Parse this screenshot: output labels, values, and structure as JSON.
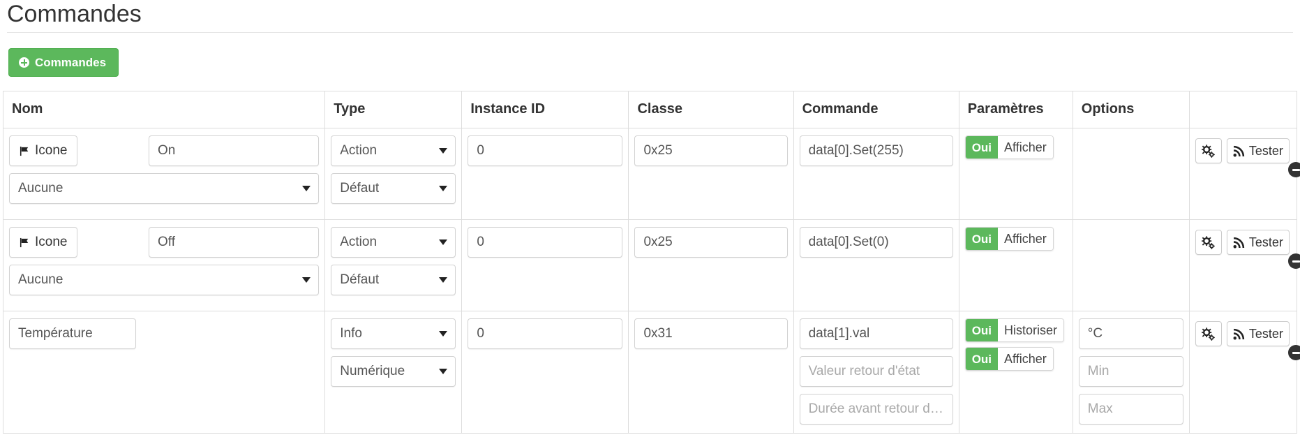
{
  "page": {
    "title": "Commandes"
  },
  "toolbar": {
    "add_label": "Commandes",
    "add_icon": "plus-circle-icon",
    "accent_color": "#5cb85c"
  },
  "table": {
    "headers": [
      "Nom",
      "Type",
      "Instance ID",
      "Classe",
      "Commande",
      "Paramètres",
      "Options",
      ""
    ],
    "icon_button_label": "Icone",
    "icon_button_icon": "flag-icon",
    "test_button_label": "Tester",
    "test_button_icon": "rss-signal-icon",
    "config_button_icon": "gears-icon",
    "remove_button_icon": "minus-circle-icon",
    "rows": [
      {
        "name_value": "On",
        "icon_select_value": "Aucune",
        "type_value": "Action",
        "subtype_value": "Défaut",
        "instance_id": "0",
        "classe": "0x25",
        "commande": "data[0].Set(255)",
        "params": [
          {
            "state": "Oui",
            "label": "Afficher"
          }
        ],
        "options": []
      },
      {
        "name_value": "Off",
        "icon_select_value": "Aucune",
        "type_value": "Action",
        "subtype_value": "Défaut",
        "instance_id": "0",
        "classe": "0x25",
        "commande": "data[0].Set(0)",
        "params": [
          {
            "state": "Oui",
            "label": "Afficher"
          }
        ],
        "options": []
      },
      {
        "name_value": "Température",
        "type_value": "Info",
        "subtype_value": "Numérique",
        "instance_id": "0",
        "classe": "0x31",
        "commande": "data[1].val",
        "commande_ph_1": "Valeur retour d'état",
        "commande_ph_2": "Durée avant retour d'état",
        "params": [
          {
            "state": "Oui",
            "label": "Historiser"
          },
          {
            "state": "Oui",
            "label": "Afficher"
          }
        ],
        "unit_value": "°C",
        "min_placeholder": "Min",
        "max_placeholder": "Max"
      }
    ]
  }
}
